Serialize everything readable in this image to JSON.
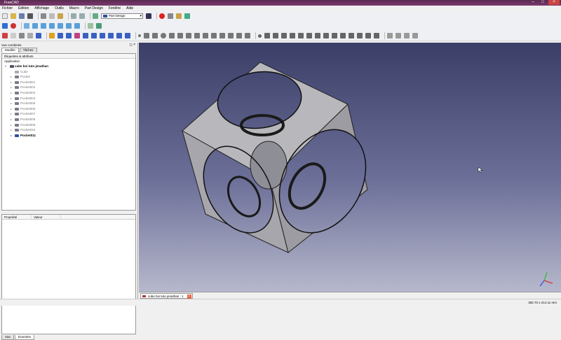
{
  "window": {
    "title": "FreeCAD"
  },
  "menu": [
    "Fichier",
    "Edition",
    "Affichage",
    "Outils",
    "Macro",
    "Part Design",
    "Fenêtre",
    "Aide"
  ],
  "toolbar": {
    "workbench": "Part Design"
  },
  "panel": {
    "title": "Vue combinée",
    "tabs": [
      "Modèle",
      "Tâches"
    ],
    "tree_header": "Étiquettes & attributs",
    "section": "Application",
    "document": "cube boi tuto jenathan",
    "items": [
      "Cube",
      "Pocket",
      "Pocket001",
      "Pocket002",
      "Pocket003",
      "Pocket004",
      "Pocket005",
      "Pocket006",
      "Pocket007",
      "Pocket008",
      "Pocket009",
      "Pocket010",
      "Pocket011"
    ],
    "active_item": "Pocket011",
    "prop_headers": [
      "Propriété",
      "Valeur"
    ],
    "bottom_tabs": [
      "Vue",
      "Données"
    ]
  },
  "viewer": {
    "doc_tab": "cube boi tuto jenathan : 1"
  },
  "status": {
    "dimensions": "382.70 x 214.11 mm"
  },
  "colors": {
    "viewport_top": "#3b3f68",
    "viewport_bottom": "#b6b8cc",
    "model_face": "#b4b4b4"
  }
}
